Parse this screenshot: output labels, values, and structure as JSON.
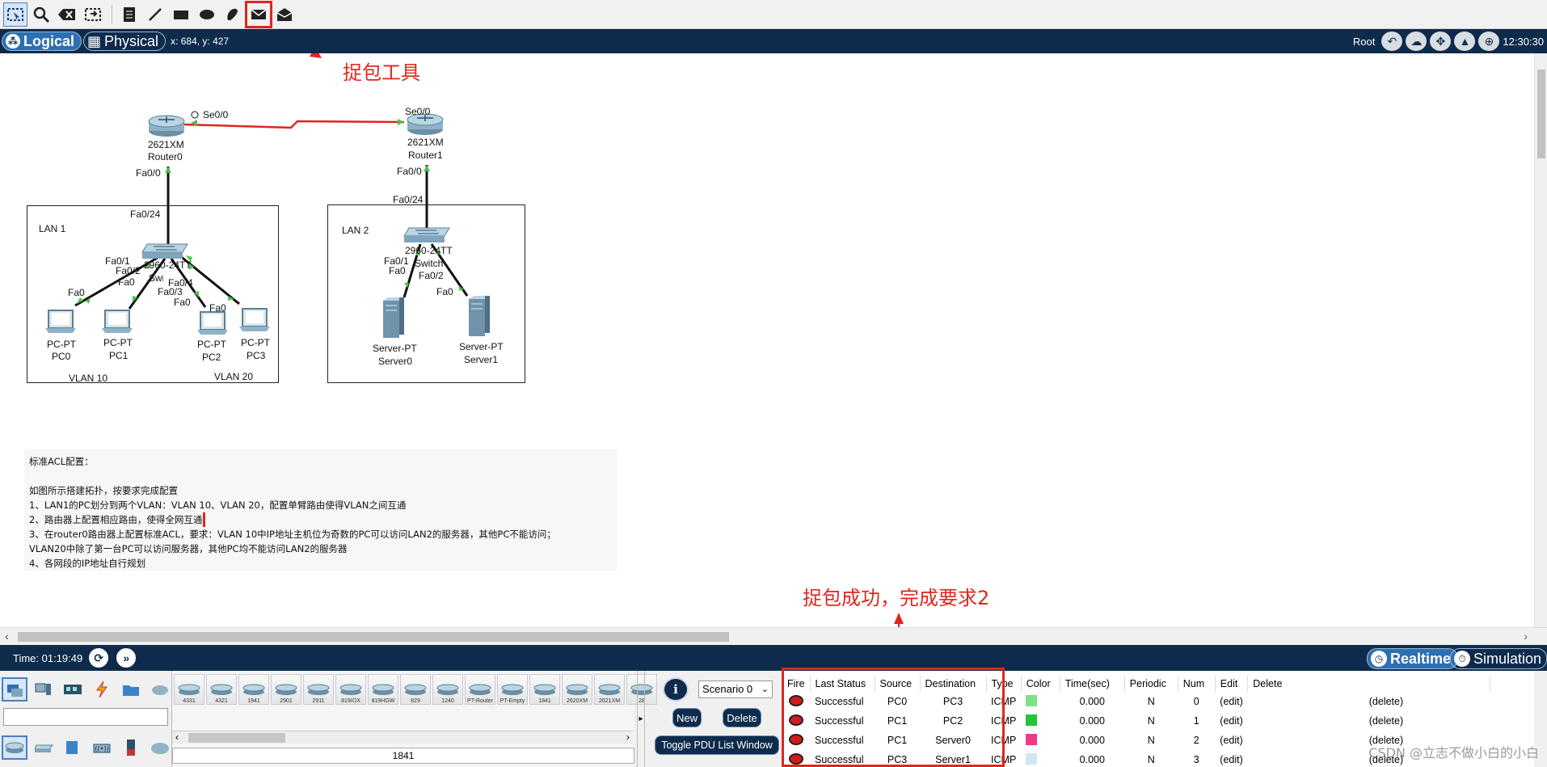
{
  "toolbar": {
    "tools": [
      "select-icon",
      "zoom-icon",
      "delete-icon",
      "resize-icon",
      "note-icon",
      "line-icon",
      "rectangle-icon",
      "ellipse-icon",
      "freeform-icon",
      "add-simple-pdu-icon",
      "add-complex-pdu-icon"
    ]
  },
  "modebar": {
    "logical": "Logical",
    "physical": "Physical",
    "coords": "x: 684, y: 427",
    "root": "Root",
    "clock": "12:30:30"
  },
  "annotations": {
    "capture_tool": "捉包工具",
    "capture_success": "捉包成功，完成要求2"
  },
  "topology": {
    "router0": {
      "model": "2621XM",
      "name": "Router0",
      "port_serial": "Se0/0",
      "port_fa": "Fa0/0"
    },
    "router1": {
      "model": "2621XM",
      "name": "Router1",
      "port_serial": "Se0/0",
      "port_fa": "Fa0/0"
    },
    "lan1": {
      "label": "LAN 1",
      "uplink": "Fa0/24",
      "switch": "2960-24TT",
      "switch_name": "Switch0",
      "vlan10": "VLAN 10",
      "vlan20": "VLAN 20",
      "ports": [
        "Fa0/1",
        "Fa0/2",
        "Fa0/3",
        "Fa0/4"
      ],
      "pc_port": "Fa0",
      "pcs": [
        {
          "model": "PC-PT",
          "name": "PC0"
        },
        {
          "model": "PC-PT",
          "name": "PC1"
        },
        {
          "model": "PC-PT",
          "name": "PC2"
        },
        {
          "model": "PC-PT",
          "name": "PC3"
        }
      ]
    },
    "lan2": {
      "label": "LAN 2",
      "uplink": "Fa0/24",
      "switch": "2960-24TT",
      "switch_name": "Switch1",
      "ports": [
        "Fa0/1",
        "Fa0/2"
      ],
      "srv_port": "Fa0",
      "servers": [
        {
          "model": "Server-PT",
          "name": "Server0"
        },
        {
          "model": "Server-PT",
          "name": "Server1"
        }
      ]
    }
  },
  "notes": {
    "title": "标准ACL配置：",
    "line0": "如图所示搭建拓扑，按要求完成配置",
    "line1": "1、LAN1的PC划分到两个VLAN：VLAN 10、VLAN 20，配置单臂路由使得VLAN之间互通",
    "line2": "2、路由器上配置相应路由，使得全网互通",
    "line3": "3、在router0路由器上配置标准ACL，要求：VLAN 10中IP地址主机位为奇数的PC可以访问LAN2的服务器，其他PC不能访问；",
    "line4": "VLAN20中除了第一台PC可以访问服务器，其他PC均不能访问LAN2的服务器",
    "line5": "4、各网段的IP地址自行规划"
  },
  "timebar": {
    "time": "Time: 01:19:49",
    "realtime": "Realtime",
    "simulation": "Simulation"
  },
  "device_strip": [
    "4331",
    "4321",
    "1941",
    "2901",
    "2911",
    "819IOX",
    "819HGW",
    "829",
    "1240",
    "PT-Router",
    "PT-Empty",
    "1841",
    "2620XM",
    "2621XM",
    "28"
  ],
  "device_selected": "1841",
  "scenario": {
    "select": "Scenario 0",
    "new": "New",
    "delete": "Delete",
    "toggle": "Toggle PDU List Window"
  },
  "pdu_headers": [
    "Fire",
    "Last Status",
    "Source",
    "Destination",
    "Type",
    "Color",
    "Time(sec)",
    "Periodic",
    "Num",
    "Edit",
    "Delete"
  ],
  "pdu_rows": [
    {
      "status": "Successful",
      "source": "PC0",
      "dest": "PC3",
      "type": "ICMP",
      "color": "#7ee08a",
      "time": "0.000",
      "periodic": "N",
      "num": "0",
      "edit": "(edit)",
      "delete": "(delete)"
    },
    {
      "status": "Successful",
      "source": "PC1",
      "dest": "PC2",
      "type": "ICMP",
      "color": "#22c43a",
      "time": "0.000",
      "periodic": "N",
      "num": "1",
      "edit": "(edit)",
      "delete": "(delete)"
    },
    {
      "status": "Successful",
      "source": "PC1",
      "dest": "Server0",
      "type": "ICMP",
      "color": "#f0388a",
      "time": "0.000",
      "periodic": "N",
      "num": "2",
      "edit": "(edit)",
      "delete": "(delete)"
    },
    {
      "status": "Successful",
      "source": "PC3",
      "dest": "Server1",
      "type": "ICMP",
      "color": "#cfe8f0",
      "time": "0.000",
      "periodic": "N",
      "num": "3",
      "edit": "(edit)",
      "delete": "(delete)"
    }
  ],
  "watermark": "CSDN @立志不做小白的小白",
  "colors": {
    "accent": "#0e2b4c",
    "highlight": "#e0261d",
    "link": "#e0261d",
    "port_indicator": "#4cc24a"
  }
}
